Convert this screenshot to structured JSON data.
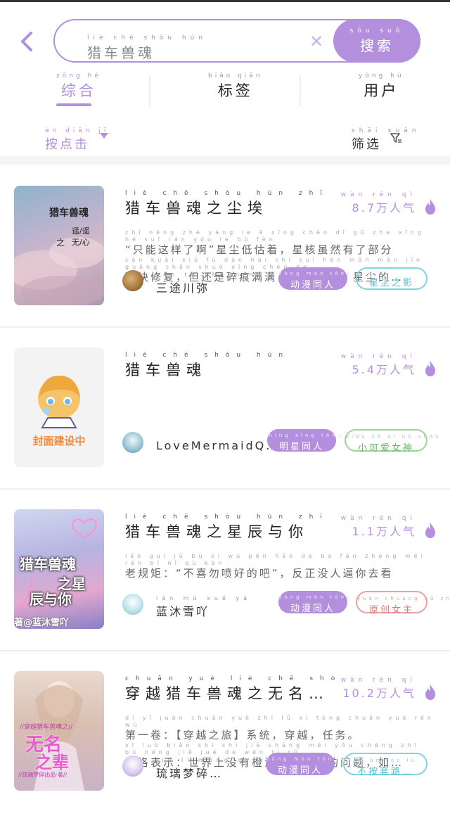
{
  "search": {
    "query": "猎车兽魂",
    "query_pinyin": "liè chē shòu hún",
    "button_label": "搜索",
    "button_pinyin": "sōu suǒ"
  },
  "tabs": [
    {
      "label": "综合",
      "pinyin": "zōng hé"
    },
    {
      "label": "标签",
      "pinyin": "biāo qiān"
    },
    {
      "label": "用户",
      "pinyin": "yòng hù"
    }
  ],
  "sort": {
    "label": "按点击",
    "pinyin": "àn diǎn jī"
  },
  "filter": {
    "label": "筛选",
    "pinyin": "shāi xuǎn"
  },
  "results": [
    {
      "title": "猎车兽魂之尘埃",
      "title_pinyin": "liè chē shòu hún zhī chén āi",
      "popularity": "8.7万人气",
      "popularity_pinyin": "wàn rén qì",
      "desc_line1": "“只能这样了啊”星尘低估着，星核虽然有了部分",
      "desc_line1_pinyin": "zhǐ néng zhè yàng le ā xīng chén dī gū zhe xīng hé suī rán yǒu le bù fèn",
      "desc_line2": "残块修复，但还是碎痕满满，金光闪烁，星尘的…",
      "desc_line2_pinyin": "cán kuài xiū fù dàn hái shì suì hén mǎn mǎn jīn guāng shǎn shuò xīng chén de",
      "author": "三途川弥",
      "author_pinyin": "sān tú chuān mí",
      "tags": [
        {
          "label": "动漫同人",
          "pinyin": "dòng màn tóng rén"
        },
        {
          "label": "星尘之影",
          "pinyin": ""
        }
      ],
      "cover_text_1": "猎车兽魂",
      "cover_text_2": "之",
      "cover_text_3": "遥/遥",
      "cover_text_4": "无/心"
    },
    {
      "title": "猎车兽魂",
      "title_pinyin": "liè chē shòu hún",
      "popularity": "5.4万人气",
      "popularity_pinyin": "wàn rén qì",
      "desc_line1": "",
      "desc_line1_pinyin": "",
      "desc_line2": "",
      "desc_line2_pinyin": "",
      "author": "LoveMermaidQ…",
      "author_pinyin": "",
      "tags": [
        {
          "label": "明星同人",
          "pinyin": "míng xīng tóng rén"
        },
        {
          "label": "小可爱女神",
          "pinyin": "xiǎo kě ài nǚ shén"
        }
      ],
      "cover_text_1": "封面建设中",
      "cover_text_2": "",
      "cover_text_3": "",
      "cover_text_4": ""
    },
    {
      "title": "猎车兽魂之星辰与你",
      "title_pinyin": "liè chē shòu hún zhī xīng chén yǔ nǐ",
      "popularity": "1.1万人气",
      "popularity_pinyin": "wàn rén qì",
      "desc_line1": "老规矩：“不喜勿喷好的吧”，反正没人逼你去看",
      "desc_line1_pinyin": "lǎo guī jǔ bù xǐ wù pēn hǎo de ba fǎn zhèng méi rén bī nǐ qù kàn",
      "desc_line2": "",
      "desc_line2_pinyin": "",
      "author": "蓝沐雪吖",
      "author_pinyin": "lán mù xuě yā",
      "tags": [
        {
          "label": "动漫同人",
          "pinyin": "dòng màn tóng rén"
        },
        {
          "label": "原创女主",
          "pinyin": "yuán chuàng nǚ zhǔ"
        }
      ],
      "cover_text_1": "猎车兽魂",
      "cover_text_2": "之星",
      "cover_text_3": "辰与你",
      "cover_text_4": "著@蓝沐雪吖"
    },
    {
      "title": "穿越猎车兽魂之无名…",
      "title_pinyin": "chuān yuè liè chē shòu hún zhī wú míng",
      "popularity": "10.2万人气",
      "popularity_pinyin": "wàn rén qì",
      "desc_line1": "第一卷：【穿越之旅】系统，穿越，任务。",
      "desc_line1_pinyin": "dì yī juàn chuān yuè zhī lǚ xì tǒng chuān yuè rèn wù",
      "desc_line2": "兮洛表示：世界上没有橙汁不能解决的问题，如…",
      "desc_line2_pinyin": "xī luò biǎo shì shì jiè shàng méi yǒu chéng zhī bù néng jiě jué de wèn tí rú",
      "author": "琉璃梦碎…",
      "author_pinyin": "liú lí mèng suì",
      "tags": [
        {
          "label": "动漫同人",
          "pinyin": "dòng màn tóng rén"
        },
        {
          "label": "不按套路…",
          "pinyin": "bù àn tào lù"
        }
      ],
      "cover_text_1": "//穿越猎车兽魂之//",
      "cover_text_2": "无名",
      "cover_text_3": "之辈",
      "cover_text_4": "//琉璃梦碎出品·著//"
    }
  ],
  "colors": {
    "accent": "#b48fdd",
    "cyan": "#4fc0d0",
    "green": "#66b566",
    "red": "#dd7777"
  }
}
